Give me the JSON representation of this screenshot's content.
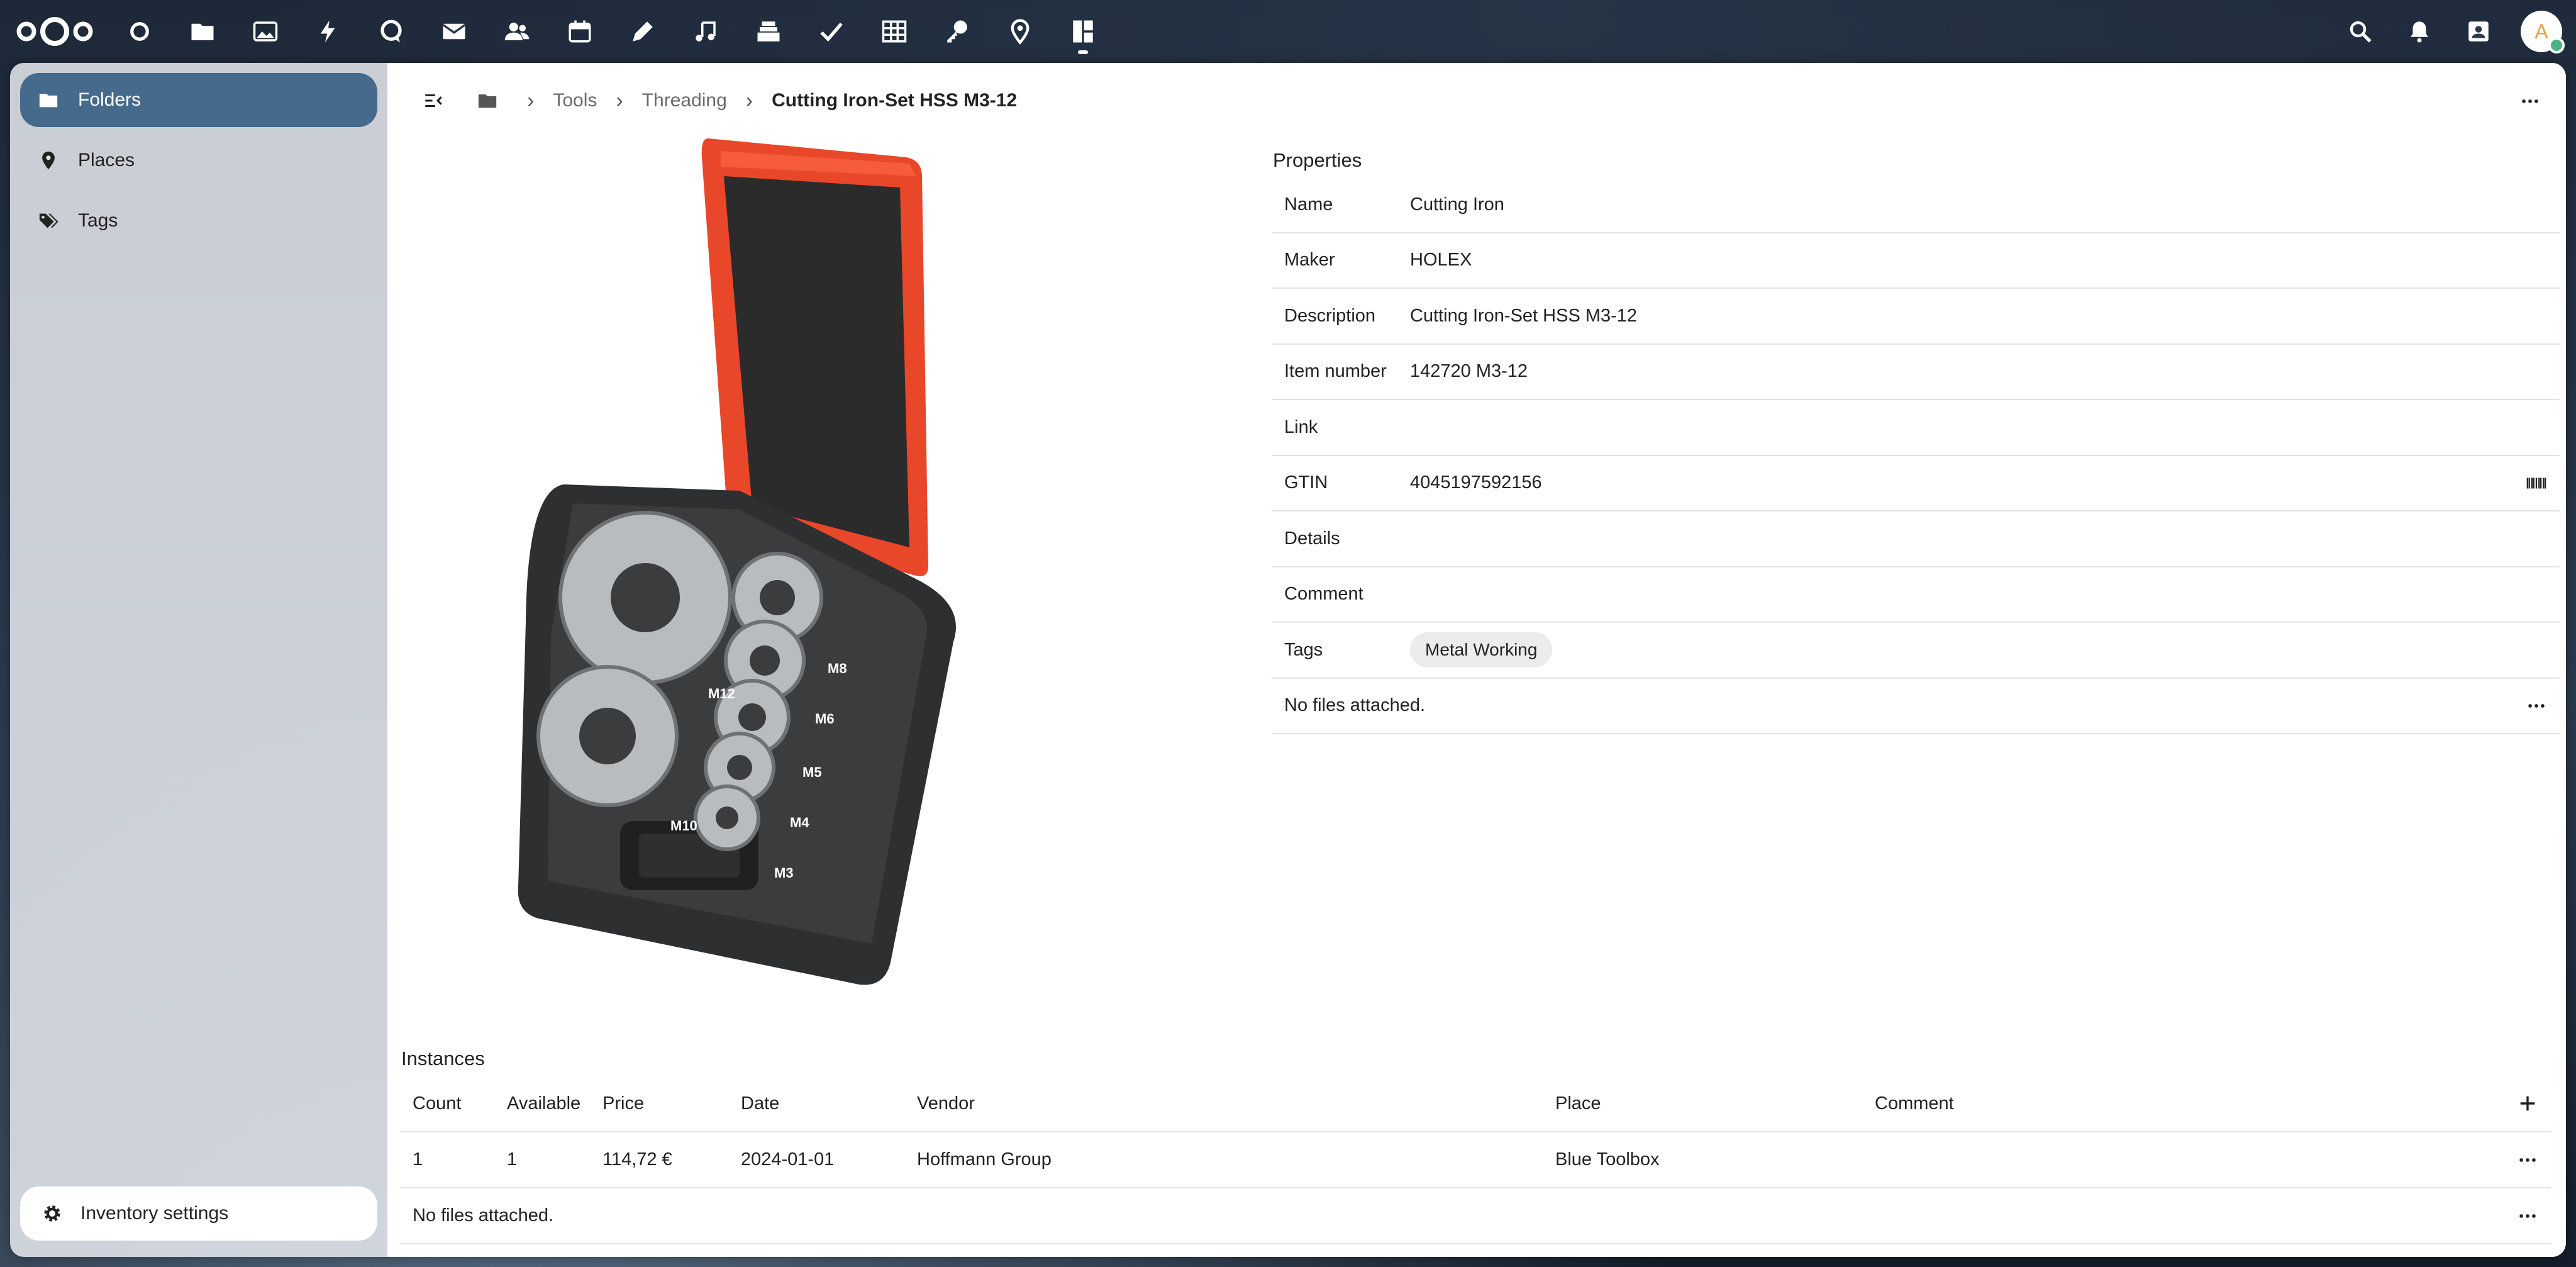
{
  "topbar": {
    "apps": [
      {
        "name": "dashboard",
        "icon": "circle-icon"
      },
      {
        "name": "files",
        "icon": "folder-icon"
      },
      {
        "name": "photos",
        "icon": "image-icon"
      },
      {
        "name": "activity",
        "icon": "lightning-icon"
      },
      {
        "name": "talk",
        "icon": "chat-icon"
      },
      {
        "name": "mail",
        "icon": "mail-icon"
      },
      {
        "name": "contacts",
        "icon": "contacts-icon"
      },
      {
        "name": "calendar",
        "icon": "calendar-icon"
      },
      {
        "name": "notes",
        "icon": "pencil-icon"
      },
      {
        "name": "music",
        "icon": "music-icon"
      },
      {
        "name": "deck",
        "icon": "deck-icon"
      },
      {
        "name": "tasks",
        "icon": "check-icon"
      },
      {
        "name": "tables",
        "icon": "table-icon"
      },
      {
        "name": "passwords",
        "icon": "key-icon"
      },
      {
        "name": "maps",
        "icon": "map-pin-icon"
      },
      {
        "name": "inventory",
        "icon": "inventory-icon",
        "active": true
      }
    ],
    "avatar_initial": "A"
  },
  "sidebar": {
    "items": [
      {
        "label": "Folders",
        "icon": "folder-icon",
        "active": true
      },
      {
        "label": "Places",
        "icon": "map-pin-icon"
      },
      {
        "label": "Tags",
        "icon": "tags-icon"
      }
    ],
    "settings_label": "Inventory settings"
  },
  "breadcrumb": {
    "items": [
      "Tools",
      "Threading"
    ],
    "current": "Cutting Iron-Set HSS M3-12"
  },
  "properties": {
    "title": "Properties",
    "rows": [
      {
        "key": "Name",
        "value": "Cutting Iron"
      },
      {
        "key": "Maker",
        "value": "HOLEX"
      },
      {
        "key": "Description",
        "value": "Cutting Iron-Set HSS M3-12"
      },
      {
        "key": "Item number",
        "value": "142720 M3-12"
      },
      {
        "key": "Link",
        "value": ""
      },
      {
        "key": "GTIN",
        "value": "4045197592156"
      },
      {
        "key": "Details",
        "value": ""
      },
      {
        "key": "Comment",
        "value": ""
      }
    ],
    "tags_label": "Tags",
    "tags": [
      "Metal Working"
    ],
    "files_text": "No files attached."
  },
  "instances": {
    "title": "Instances",
    "columns": [
      "Count",
      "Available",
      "Price",
      "Date",
      "Vendor",
      "Place",
      "Comment"
    ],
    "rows": [
      {
        "count": "1",
        "available": "1",
        "price": "114,72 €",
        "date": "2024-01-01",
        "vendor": "Hoffmann Group",
        "place": "Blue Toolbox",
        "comment": ""
      }
    ],
    "files_text": "No files attached."
  },
  "image": {
    "die_labels": [
      "M12",
      "M10",
      "M8",
      "M6",
      "M5",
      "M4",
      "M3"
    ],
    "colors": {
      "lid": "#e8472a",
      "case": "#2d2f31"
    }
  }
}
